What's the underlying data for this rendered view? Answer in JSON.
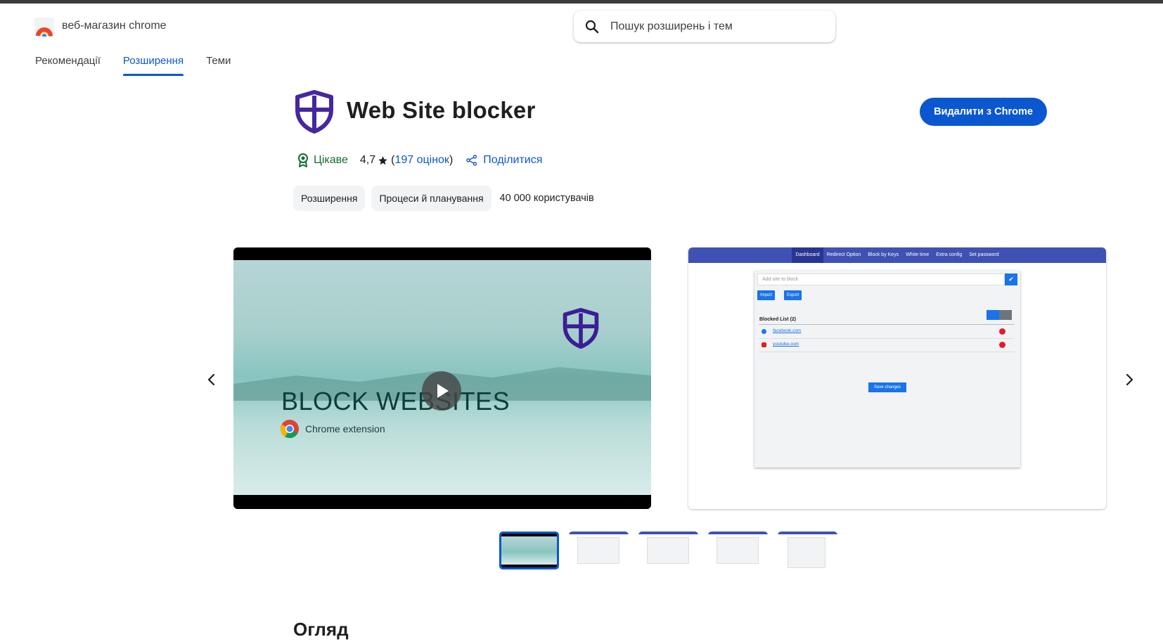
{
  "header": {
    "logo_text": "веб-магазин chrome",
    "search_placeholder": "Пошук розширень і тем"
  },
  "nav": {
    "tabs": [
      {
        "label": "Рекомендації",
        "active": false
      },
      {
        "label": "Розширення",
        "active": true
      },
      {
        "label": "Теми",
        "active": false
      }
    ]
  },
  "extension": {
    "title": "Web Site blocker",
    "remove_button": "Видалити з Chrome",
    "featured_label": "Цікаве",
    "rating": "4,7",
    "ratings_count": "197 оцінок",
    "share_label": "Поділитися",
    "categories": [
      "Розширення",
      "Процеси й планування"
    ],
    "users": "40 000 користувачів"
  },
  "media": {
    "video": {
      "headline": "BLOCK WEBSITES",
      "subtitle": "Chrome extension"
    },
    "screenshot": {
      "nav_items": [
        "Dashboard",
        "Redirect Option",
        "Block by Keys",
        "White time",
        "Extra config",
        "Set password"
      ],
      "active_nav": "Dashboard",
      "input_placeholder": "Add site to block",
      "import_label": "Import",
      "export_label": "Export",
      "list_title": "Blocked List (2)",
      "sites": [
        {
          "name": "facebook.com",
          "color": "#1877f2"
        },
        {
          "name": "youtube.com",
          "color": "#e62117"
        }
      ],
      "save_label": "Save changes"
    },
    "thumbnail_count": 5,
    "active_thumbnail": 0
  },
  "sections": {
    "overview_title": "Огляд"
  },
  "colors": {
    "accent": "#0b57d0",
    "featured_green": "#146c2e",
    "shield_purple": "#4527a0"
  }
}
